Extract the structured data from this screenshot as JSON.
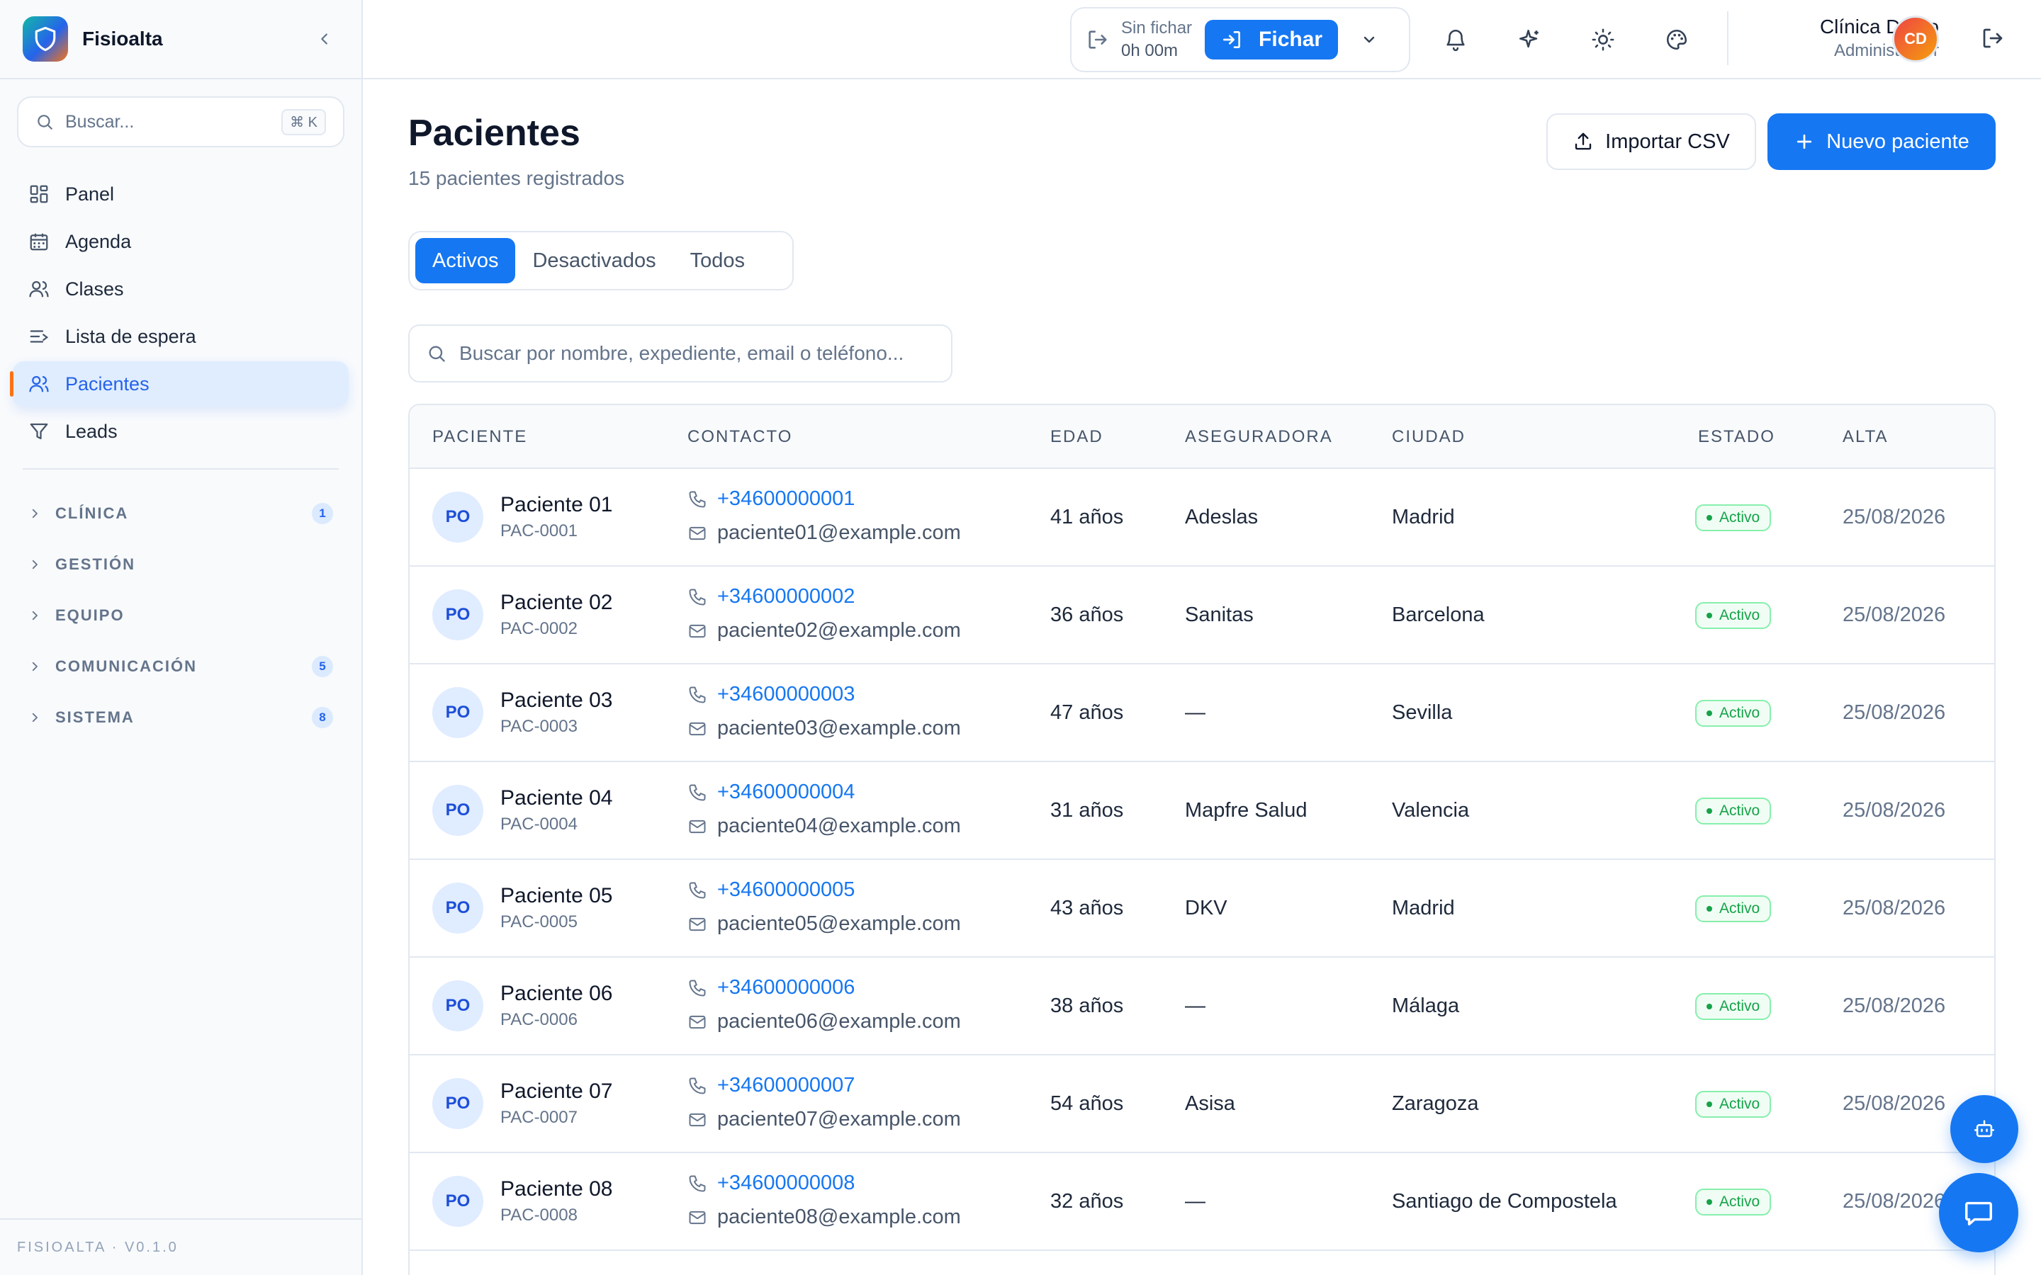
{
  "sidebar": {
    "brand": "Fisioalta",
    "search": {
      "placeholder": "Buscar...",
      "shortcut": "⌘ K"
    },
    "nav": [
      {
        "label": "Panel",
        "icon": "dashboard-icon"
      },
      {
        "label": "Agenda",
        "icon": "calendar-icon"
      },
      {
        "label": "Clases",
        "icon": "users-icon"
      },
      {
        "label": "Lista de espera",
        "icon": "list-icon"
      },
      {
        "label": "Pacientes",
        "icon": "users-icon",
        "active": true
      },
      {
        "label": "Leads",
        "icon": "filter-icon"
      }
    ],
    "groups": [
      {
        "label": "CLÍNICA",
        "badge": "1"
      },
      {
        "label": "GESTIÓN",
        "badge": ""
      },
      {
        "label": "EQUIPO",
        "badge": ""
      },
      {
        "label": "COMUNICACIÓN",
        "badge": "5"
      },
      {
        "label": "SISTEMA",
        "badge": "8"
      }
    ],
    "footer": "FISIOALTA · V0.1.0"
  },
  "topbar": {
    "clock_status": "Sin fichar",
    "clock_time": "0h 00m",
    "fichar_label": "Fichar",
    "user_name": "Clínica Demo",
    "user_role": "Administrador",
    "avatar_initials": "CD"
  },
  "main": {
    "title": "Pacientes",
    "subtitle": "15 pacientes registrados",
    "import_label": "Importar CSV",
    "new_label": "Nuevo paciente",
    "tabs": [
      "Activos",
      "Desactivados",
      "Todos"
    ],
    "search_placeholder": "Buscar por nombre, expediente, email o teléfono...",
    "columns": [
      "PACIENTE",
      "CONTACTO",
      "EDAD",
      "ASEGURADORA",
      "CIUDAD",
      "ESTADO",
      "ALTA"
    ],
    "rows": [
      {
        "initials": "PO",
        "name": "Paciente 01",
        "code": "PAC-0001",
        "phone": "+34600000001",
        "email": "paciente01@example.com",
        "age": "41 años",
        "insurer": "Adeslas",
        "city": "Madrid",
        "status": "Activo",
        "alta": "25/08/2026"
      },
      {
        "initials": "PO",
        "name": "Paciente 02",
        "code": "PAC-0002",
        "phone": "+34600000002",
        "email": "paciente02@example.com",
        "age": "36 años",
        "insurer": "Sanitas",
        "city": "Barcelona",
        "status": "Activo",
        "alta": "25/08/2026"
      },
      {
        "initials": "PO",
        "name": "Paciente 03",
        "code": "PAC-0003",
        "phone": "+34600000003",
        "email": "paciente03@example.com",
        "age": "47 años",
        "insurer": "—",
        "city": "Sevilla",
        "status": "Activo",
        "alta": "25/08/2026"
      },
      {
        "initials": "PO",
        "name": "Paciente 04",
        "code": "PAC-0004",
        "phone": "+34600000004",
        "email": "paciente04@example.com",
        "age": "31 años",
        "insurer": "Mapfre Salud",
        "city": "Valencia",
        "status": "Activo",
        "alta": "25/08/2026"
      },
      {
        "initials": "PO",
        "name": "Paciente 05",
        "code": "PAC-0005",
        "phone": "+34600000005",
        "email": "paciente05@example.com",
        "age": "43 años",
        "insurer": "DKV",
        "city": "Madrid",
        "status": "Activo",
        "alta": "25/08/2026"
      },
      {
        "initials": "PO",
        "name": "Paciente 06",
        "code": "PAC-0006",
        "phone": "+34600000006",
        "email": "paciente06@example.com",
        "age": "38 años",
        "insurer": "—",
        "city": "Málaga",
        "status": "Activo",
        "alta": "25/08/2026"
      },
      {
        "initials": "PO",
        "name": "Paciente 07",
        "code": "PAC-0007",
        "phone": "+34600000007",
        "email": "paciente07@example.com",
        "age": "54 años",
        "insurer": "Asisa",
        "city": "Zaragoza",
        "status": "Activo",
        "alta": "25/08/2026"
      },
      {
        "initials": "PO",
        "name": "Paciente 08",
        "code": "PAC-0008",
        "phone": "+34600000008",
        "email": "paciente08@example.com",
        "age": "32 años",
        "insurer": "—",
        "city": "Santiago de Compostela",
        "status": "Activo",
        "alta": "25/08/2026"
      }
    ]
  },
  "colors": {
    "accent": "#1677f2",
    "active_green": "#16a34a",
    "sidebar_bg": "#f8fafc",
    "border": "#e2e8f0"
  }
}
